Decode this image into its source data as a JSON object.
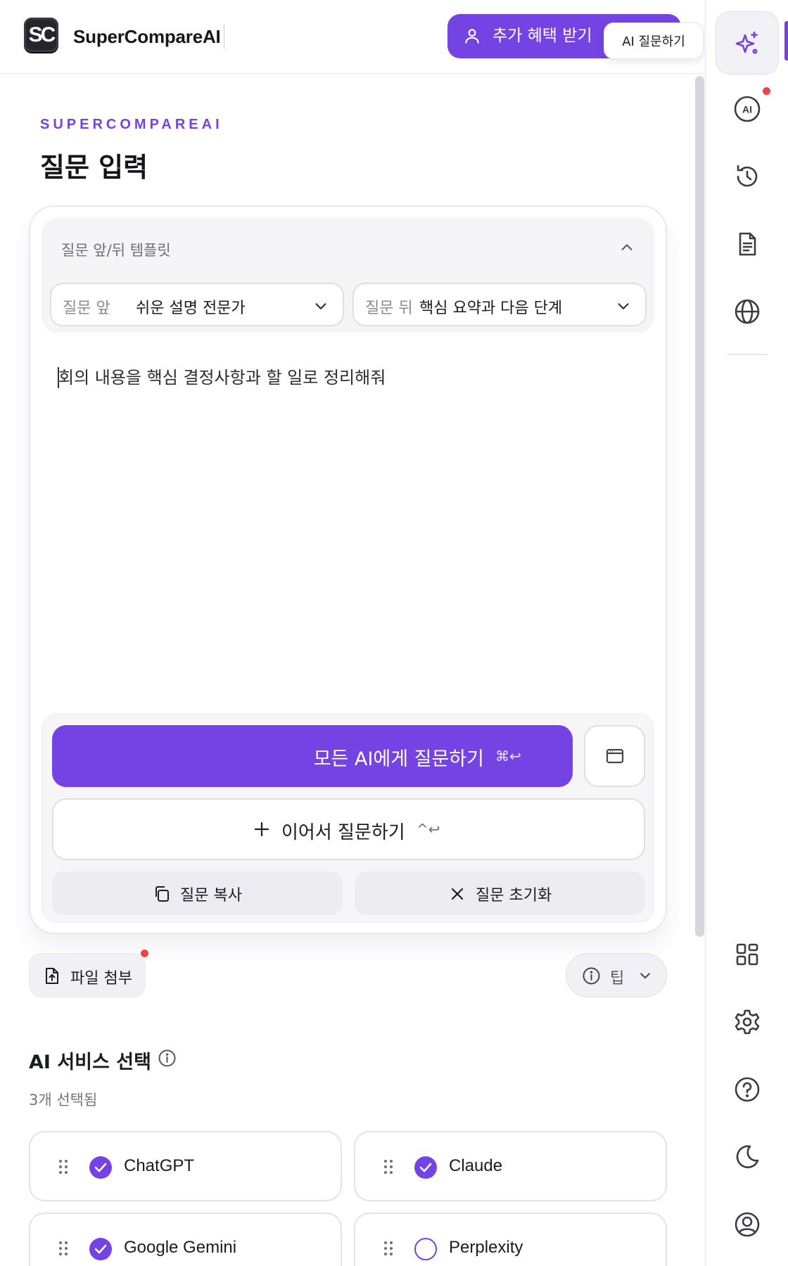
{
  "header": {
    "logo_text": "SC",
    "brand": "SuperCompareAI",
    "promo_button": "추가 혜택 받기",
    "tooltip": "AI 질문하기"
  },
  "rail": {
    "accent": "#7543e3",
    "top_icons": [
      "sparkle-icon",
      "ai-icon",
      "history-icon",
      "document-icon",
      "globe-icon"
    ],
    "bottom_icons": [
      "grid-icon",
      "gear-icon",
      "help-icon",
      "moon-icon",
      "user-icon"
    ]
  },
  "heading": {
    "eyebrow": "SUPERCOMPAREAI",
    "title": "질문 입력"
  },
  "template": {
    "title": "질문 앞/뒤 템플릿",
    "before_label": "질문 앞",
    "before_value": "쉬운 설명 전문가",
    "after_label": "질문 뒤",
    "after_value": "핵심 요약과 다음 단계"
  },
  "query": {
    "value": "회의 내용을 핵심 결정사항과 할 일로 정리해줘"
  },
  "actions": {
    "ask_all": "모든 AI에게 질문하기",
    "ask_all_shortcut": "⌘↩",
    "follow_up": "이어서 질문하기",
    "follow_up_shortcut": "^↩",
    "copy": "질문 복사",
    "reset": "질문 초기화"
  },
  "attach": {
    "label": "파일 첨부"
  },
  "tip": {
    "label": "팁"
  },
  "services": {
    "title": "AI 서비스 선택",
    "count": "3개 선택됨",
    "items": [
      {
        "name": "ChatGPT",
        "selected": true
      },
      {
        "name": "Claude",
        "selected": true
      },
      {
        "name": "Google Gemini",
        "selected": true
      },
      {
        "name": "Perplexity",
        "selected": false
      }
    ]
  }
}
